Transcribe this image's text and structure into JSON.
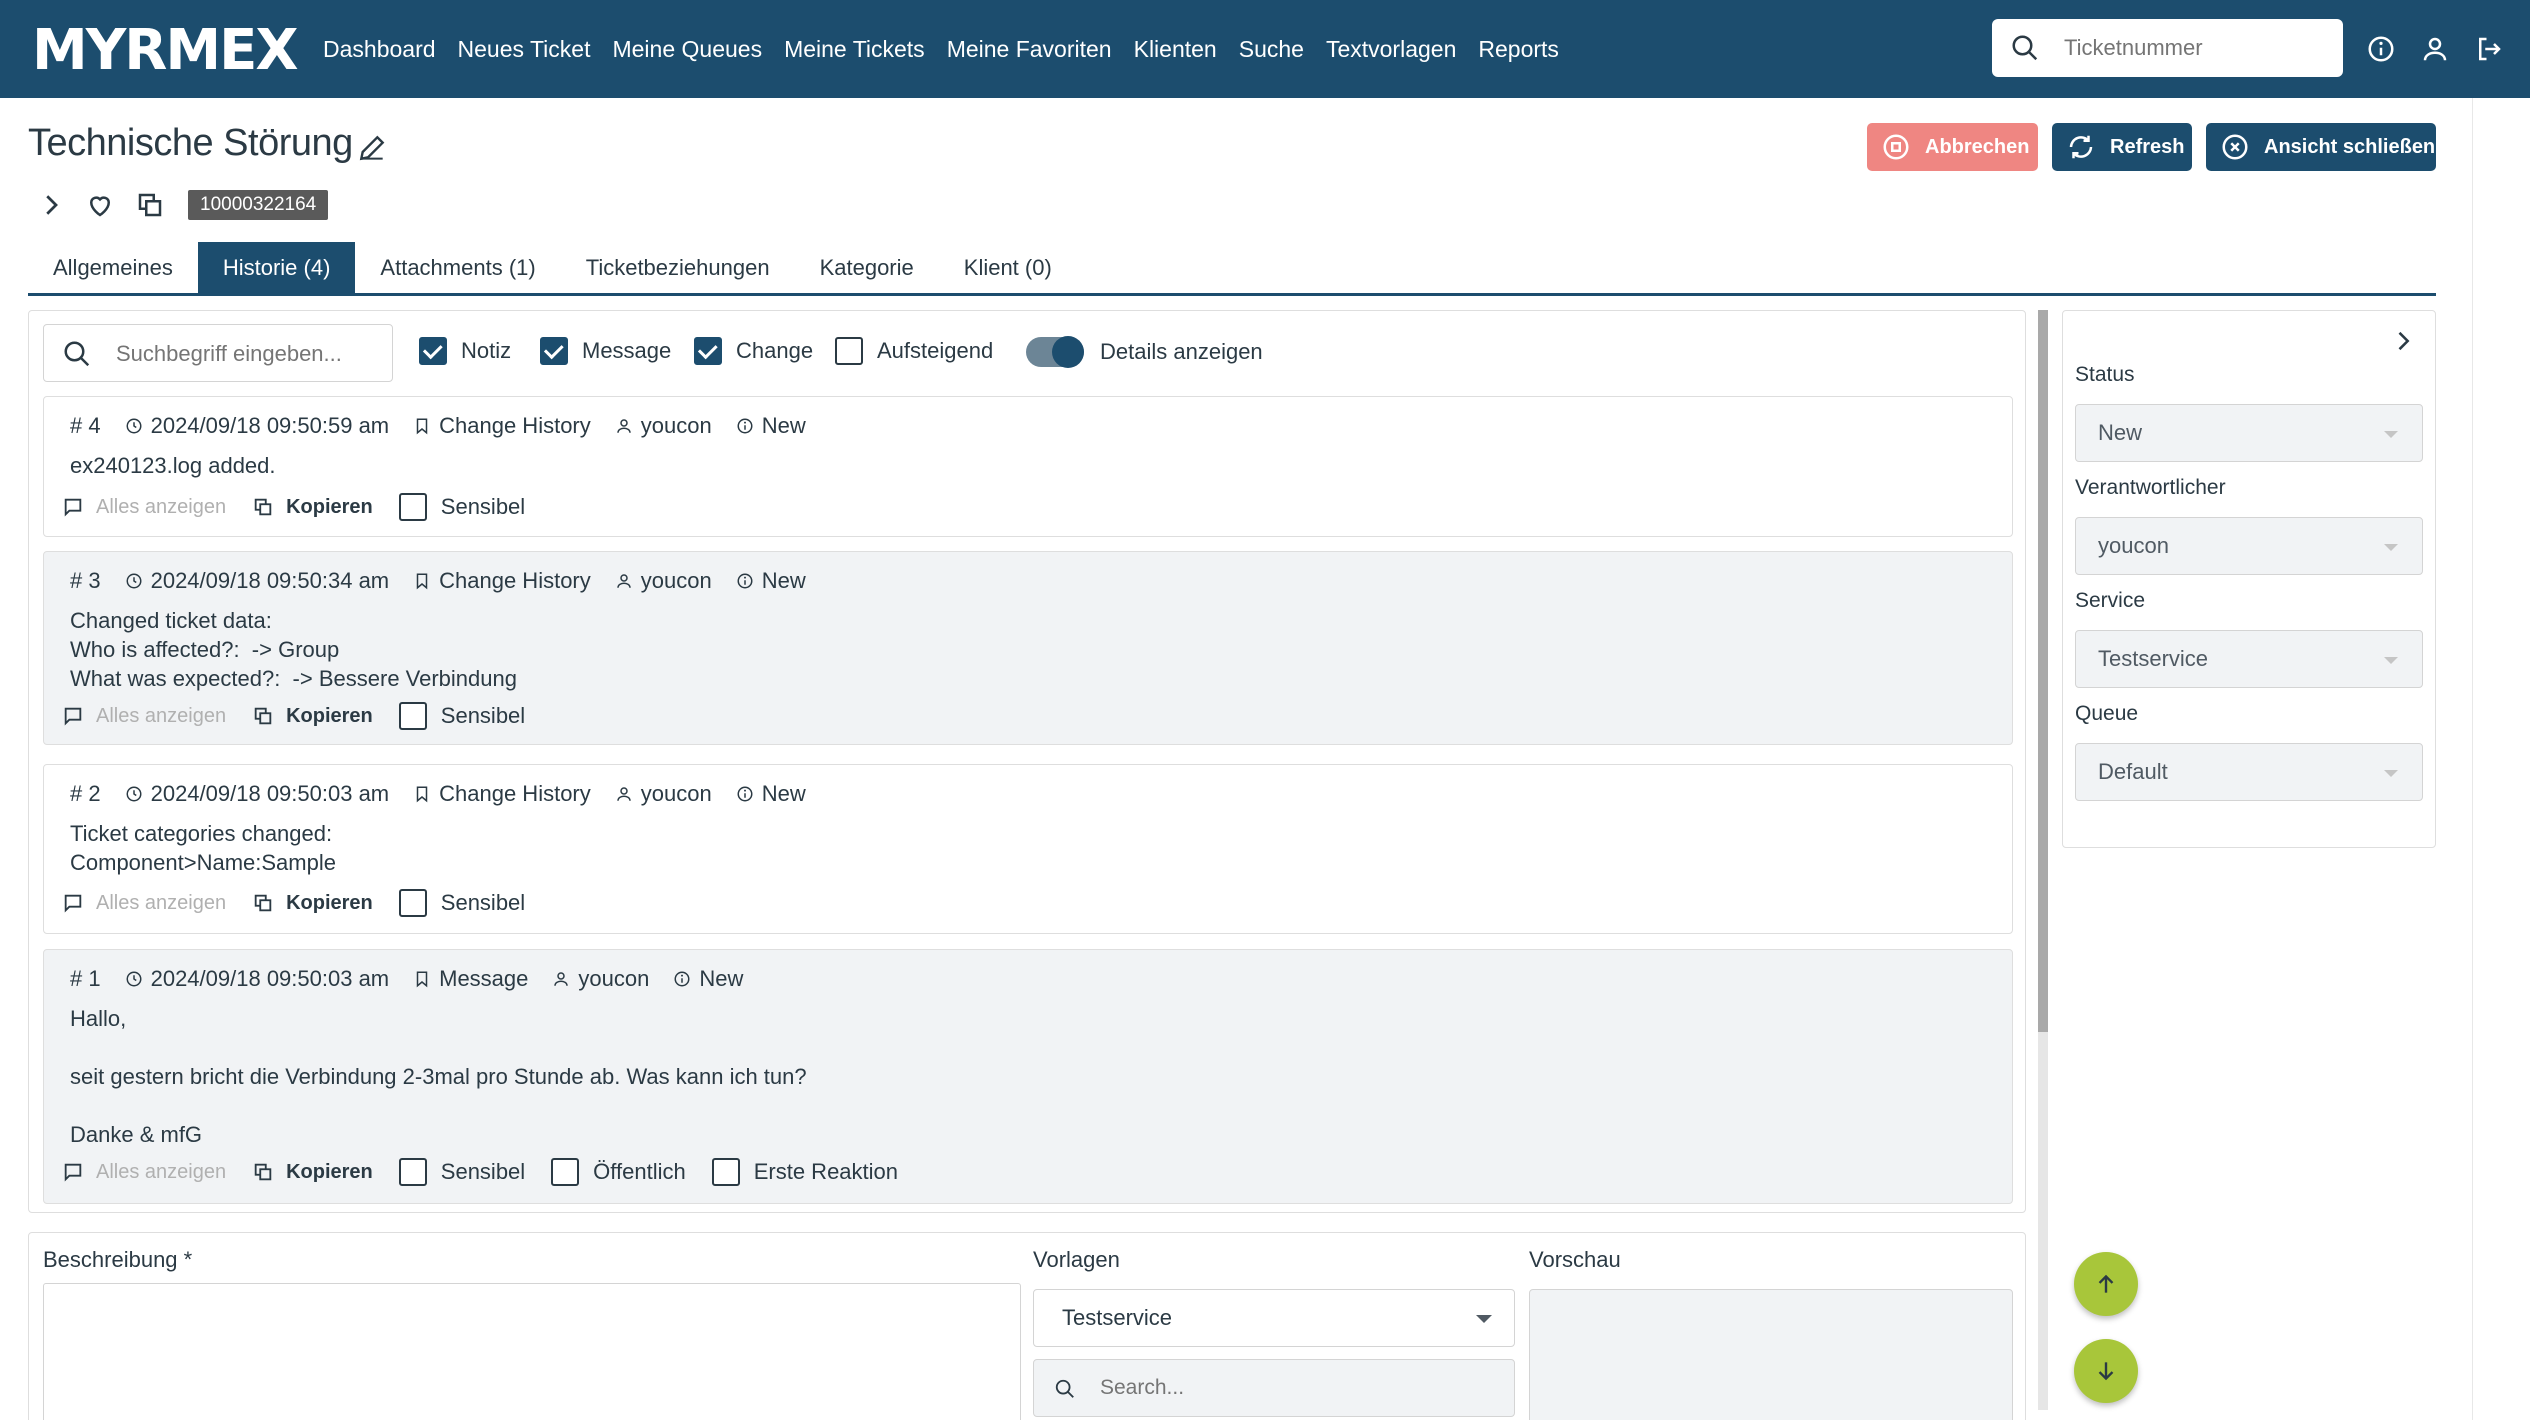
{
  "app": {
    "logo": "MYRMEX"
  },
  "nav": {
    "items": [
      "Dashboard",
      "Neues Ticket",
      "Meine Queues",
      "Meine Tickets",
      "Meine Favoriten",
      "Klienten",
      "Suche",
      "Textvorlagen",
      "Reports"
    ],
    "search_placeholder": "Ticketnummer"
  },
  "ticket": {
    "title": "Technische Störung",
    "number": "10000322164",
    "buttons": {
      "cancel": "Abbrechen",
      "refresh": "Refresh",
      "close_view": "Ansicht schließen"
    }
  },
  "tabs": [
    {
      "label": "Allgemeines",
      "active": false
    },
    {
      "label": "Historie (4)",
      "active": true
    },
    {
      "label": "Attachments (1)",
      "active": false
    },
    {
      "label": "Ticketbeziehungen",
      "active": false
    },
    {
      "label": "Kategorie",
      "active": false
    },
    {
      "label": "Klient (0)",
      "active": false
    }
  ],
  "history": {
    "search_placeholder": "Suchbegriff eingeben...",
    "filters": [
      {
        "label": "Notiz",
        "checked": true
      },
      {
        "label": "Message",
        "checked": true
      },
      {
        "label": "Change",
        "checked": true
      },
      {
        "label": "Aufsteigend",
        "checked": false
      }
    ],
    "details_toggle": {
      "label": "Details anzeigen",
      "on": true
    },
    "action_labels": {
      "show_all": "Alles anzeigen",
      "copy": "Kopieren",
      "sensitive": "Sensibel",
      "public": "Öffentlich",
      "first_response": "Erste Reaktion"
    },
    "entries": [
      {
        "id": "# 4",
        "timestamp": "2024/09/18 09:50:59 am",
        "type": "Change History",
        "user": "youcon",
        "status": "New",
        "body": "ex240123.log added."
      },
      {
        "id": "# 3",
        "timestamp": "2024/09/18 09:50:34 am",
        "type": "Change History",
        "user": "youcon",
        "status": "New",
        "body": "Changed ticket data:\nWho is affected?:  -> Group\nWhat was expected?:  -> Bessere Verbindung"
      },
      {
        "id": "# 2",
        "timestamp": "2024/09/18 09:50:03 am",
        "type": "Change History",
        "user": "youcon",
        "status": "New",
        "body": "Ticket categories changed:\nComponent>Name:Sample"
      },
      {
        "id": "# 1",
        "timestamp": "2024/09/18 09:50:03 am",
        "type": "Message",
        "user": "youcon",
        "status": "New",
        "body": "Hallo,\n\nseit gestern bricht die Verbindung 2-3mal pro Stunde ab. Was kann ich tun?\n\nDanke & mfG"
      }
    ]
  },
  "side": {
    "fields": [
      {
        "label": "Status",
        "value": "New"
      },
      {
        "label": "Verantwortlicher",
        "value": "youcon"
      },
      {
        "label": "Service",
        "value": "Testservice"
      },
      {
        "label": "Queue",
        "value": "Default"
      }
    ]
  },
  "editor": {
    "description_label": "Beschreibung *",
    "templates_label": "Vorlagen",
    "templates_value": "Testservice",
    "templates_search_placeholder": "Search...",
    "preview_label": "Vorschau"
  },
  "colors": {
    "primary": "#1c4d6e",
    "danger": "#ef8682",
    "fab": "#a8c63a",
    "shaded": "#f1f3f5"
  }
}
